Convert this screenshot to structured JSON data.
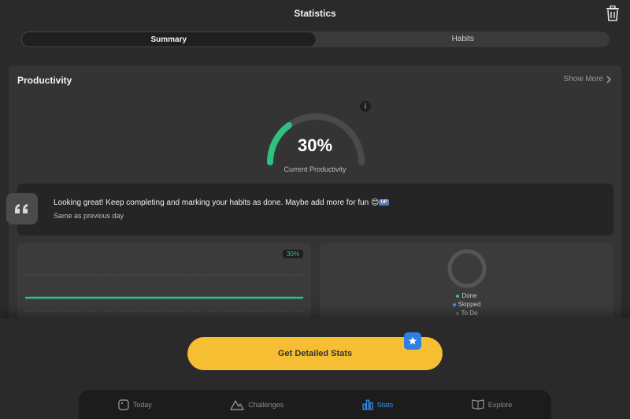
{
  "header": {
    "title": "Statistics"
  },
  "segments": [
    {
      "label": "Summary",
      "active": true
    },
    {
      "label": "Habits",
      "active": false
    }
  ],
  "productivity": {
    "title": "Productivity",
    "show_more": "Show More",
    "value": 30,
    "value_text": "30%",
    "label": "Current Productivity",
    "info": "i"
  },
  "message": {
    "text": "Looking great! Keep completing and marking your habits as done. Maybe add more for fun",
    "emoji_label": "UP",
    "subtext": "Same as previous day"
  },
  "line_panel": {
    "badge": "30%"
  },
  "legend": [
    {
      "label": "Done",
      "color": "#2ec27e"
    },
    {
      "label": "Skipped",
      "color": "#3b8ff0"
    },
    {
      "label": "To Do",
      "color": "#6a6a6a"
    }
  ],
  "cta": {
    "label": "Get Detailed Stats"
  },
  "tabs": [
    {
      "label": "Today",
      "icon": "today-icon",
      "active": false
    },
    {
      "label": "Challenges",
      "icon": "challenges-icon",
      "active": false
    },
    {
      "label": "Stats",
      "icon": "stats-icon",
      "active": true
    },
    {
      "label": "Explore",
      "icon": "explore-icon",
      "active": false
    }
  ],
  "colors": {
    "accent": "#2ec27e",
    "cta": "#f6be33",
    "active_tab": "#3b8ff0"
  }
}
